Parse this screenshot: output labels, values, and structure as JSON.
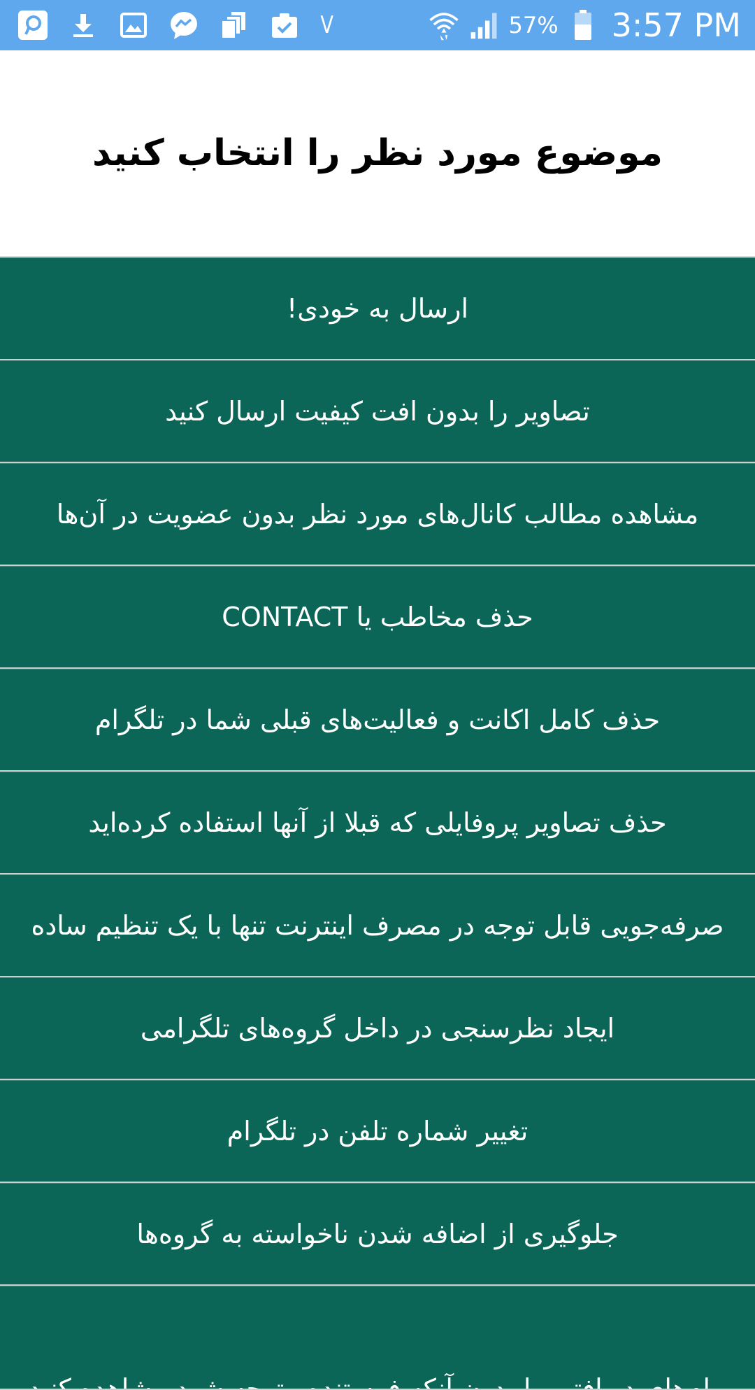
{
  "status_bar": {
    "left_icons": [
      "app-icon",
      "download-icon",
      "gallery-icon",
      "messenger-icon",
      "copy-icon",
      "clipboard-check-icon",
      "chevron-down-icon"
    ],
    "battery_percent": "57%",
    "time": "3:57 PM",
    "colors": {
      "background": "#5fa8ee",
      "foreground": "#ffffff"
    }
  },
  "header": {
    "title": "موضوع مورد نظر را انتخاب کنید"
  },
  "topics": [
    {
      "label": "ارسال به خودی!"
    },
    {
      "label": "تصاویر را بدون افت کیفیت ارسال کنید"
    },
    {
      "label": "مشاهده مطالب کانال‌های مورد نظر بدون عضویت در آن‌ها"
    },
    {
      "label": "حذف مخاطب یا CONTACT"
    },
    {
      "label": "حذف کامل اکانت و فعالیت‌های قبلی شما در تلگرام"
    },
    {
      "label": "حذف تصاویر پروفایلی که قبلا از آنها استفاده کرده‌اید"
    },
    {
      "label": "صرفه‌جویی قابل توجه در مصرف اینترنت تنها با یک تنظیم ساده"
    },
    {
      "label": "ایجاد نظرسنجی در داخل گروه‌های تلگرامی"
    },
    {
      "label": "تغییر شماره تلفن در تلگرام"
    },
    {
      "label": "جلوگیری از اضافه شدن ناخواسته به گروه‌ها"
    },
    {
      "label": "پیام‌های دریافتی را بدون آنکه فرستنده متوجه شود مشاهده کنید"
    }
  ],
  "colors": {
    "list_background": "#0b6657",
    "list_text": "#ffffff",
    "divider": "#cfcfcf"
  }
}
